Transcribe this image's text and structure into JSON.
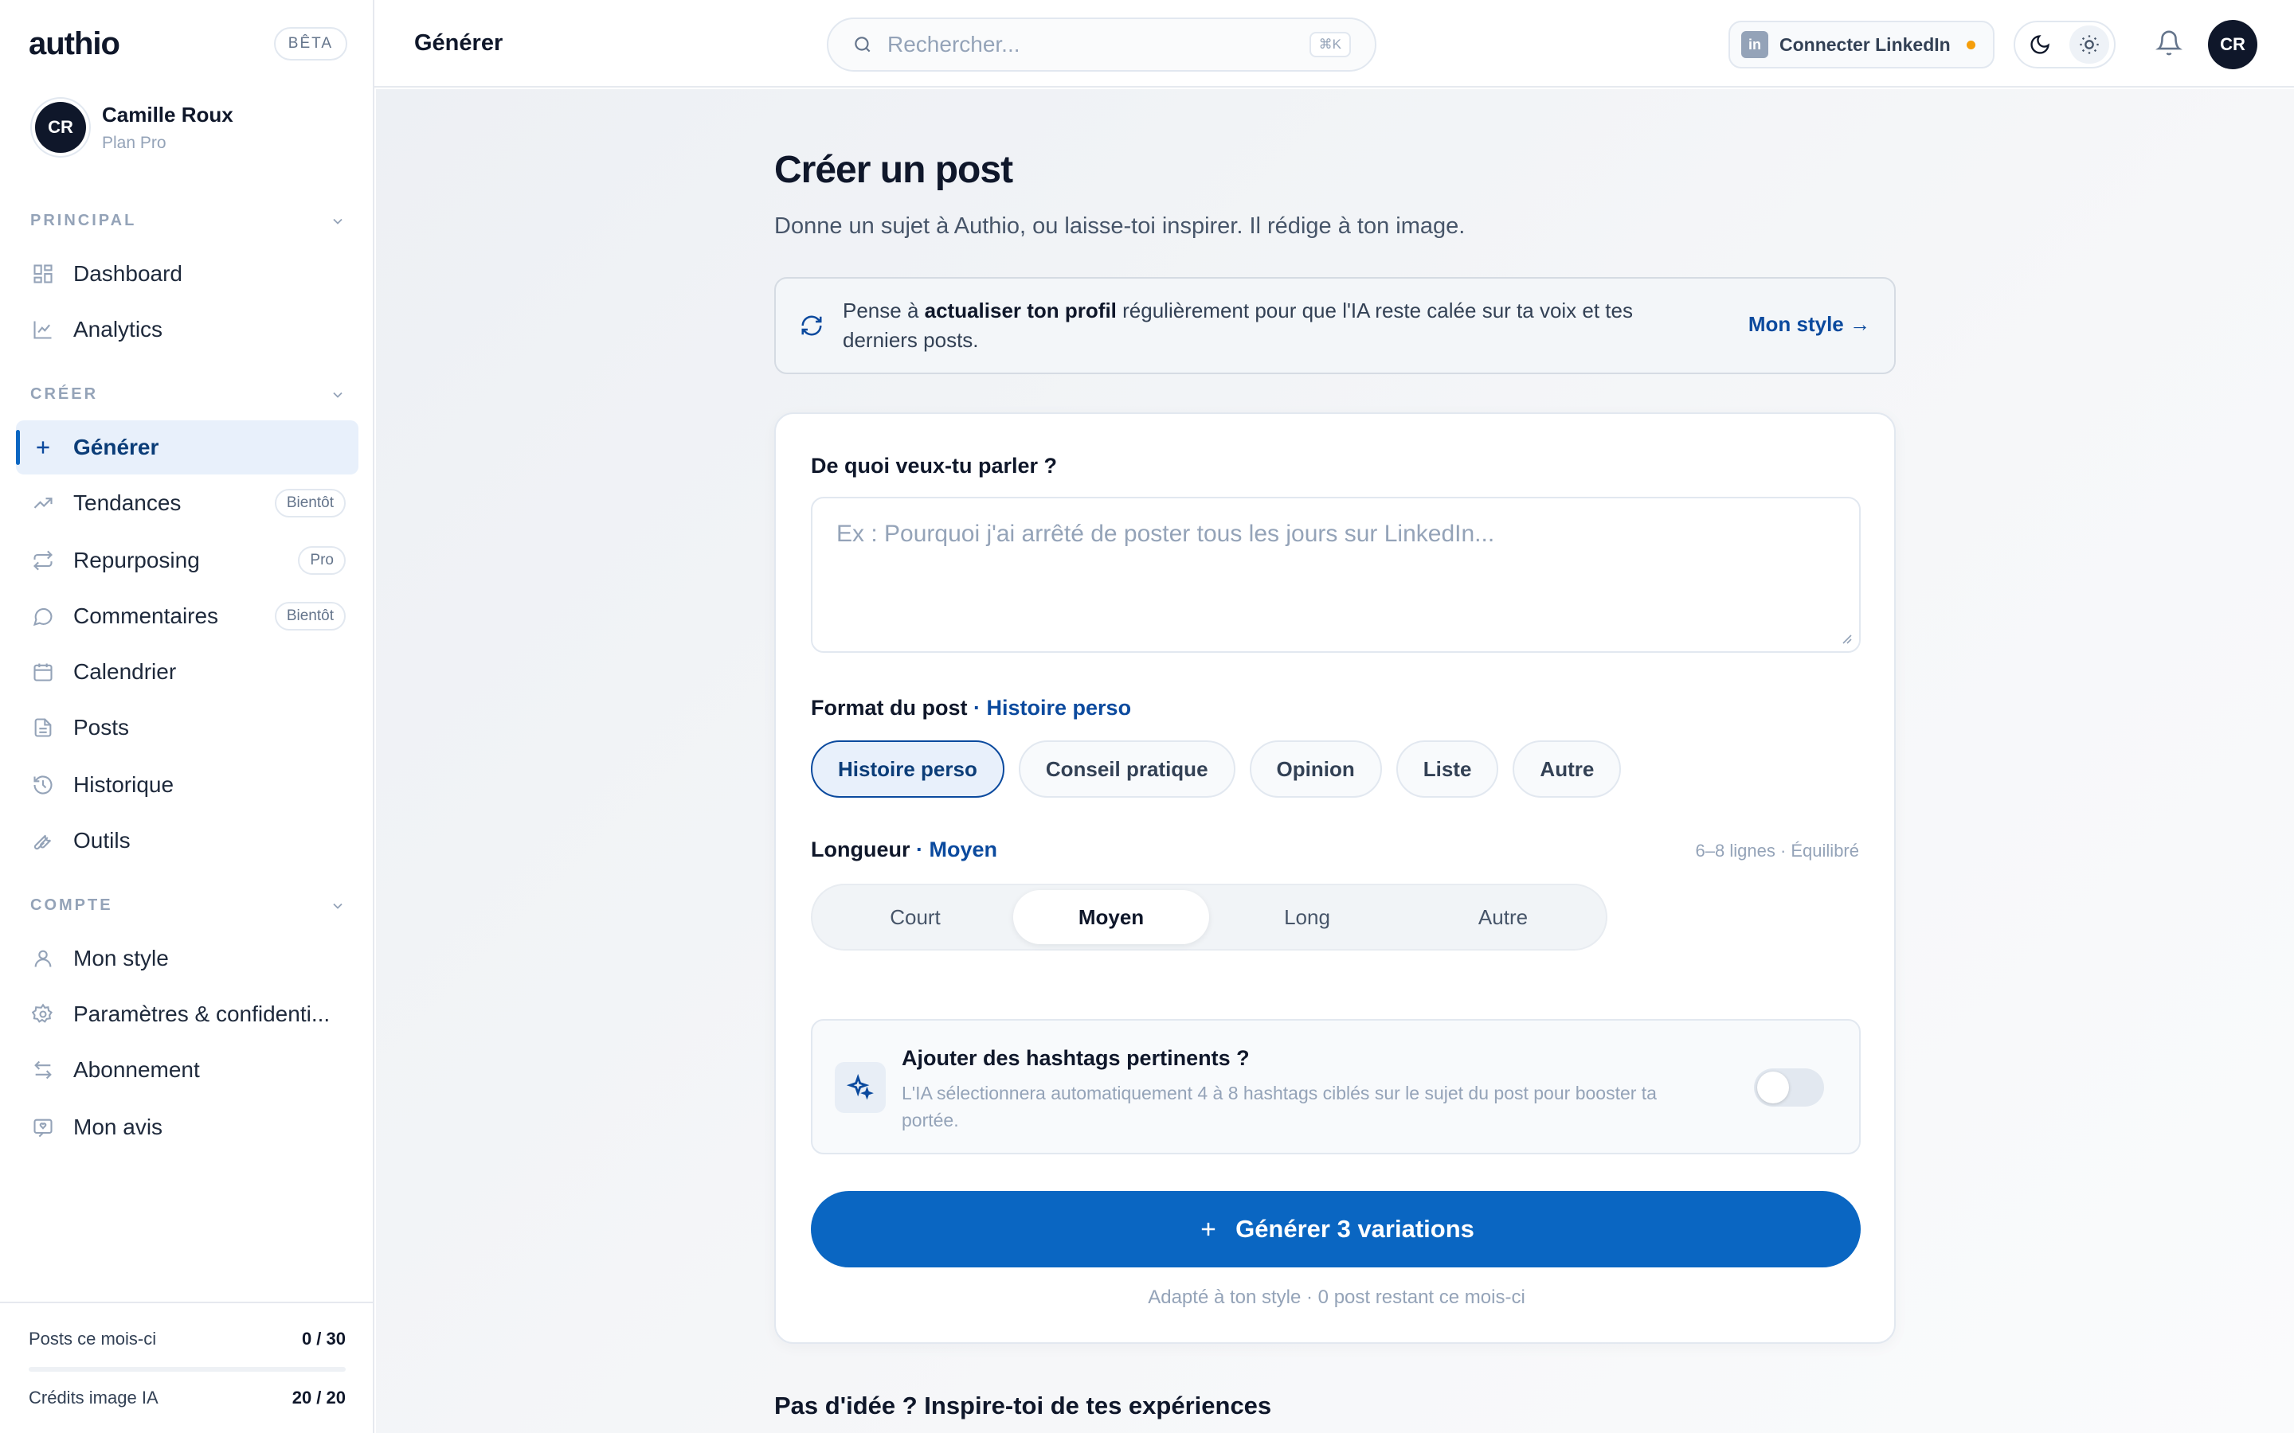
{
  "sidebar": {
    "brand": "authio",
    "beta": "BÊTA",
    "user": {
      "initials": "CR",
      "name": "Camille Roux",
      "plan": "Plan Pro"
    },
    "sections": {
      "principal": "PRINCIPAL",
      "creer": "CRÉER",
      "compte": "COMPTE"
    },
    "items": {
      "dashboard": "Dashboard",
      "analytics": "Analytics",
      "generer": "Générer",
      "tendances": "Tendances",
      "tendances_badge": "Bientôt",
      "repurposing": "Repurposing",
      "repurposing_badge": "Pro",
      "commentaires": "Commentaires",
      "commentaires_badge": "Bientôt",
      "calendrier": "Calendrier",
      "posts": "Posts",
      "historique": "Historique",
      "outils": "Outils",
      "mon_style": "Mon style",
      "parametres": "Paramètres & confidenti...",
      "abonnement": "Abonnement",
      "mon_avis": "Mon avis"
    },
    "quota": {
      "posts_label": "Posts ce mois-ci",
      "posts_value": "0 / 30",
      "posts_fraction": 0,
      "images_label": "Crédits image IA",
      "images_value": "20 / 20"
    }
  },
  "topbar": {
    "title": "Générer",
    "search_placeholder": "Rechercher...",
    "search_shortcut": "⌘K",
    "linkedin": "Connecter LinkedIn",
    "linkedin_icon": "in",
    "avatar": "CR"
  },
  "main": {
    "title": "Créer un post",
    "subtitle": "Donne un sujet à Authio, ou laisse-toi inspirer. Il rédige à ton image.",
    "tip": {
      "before": "Pense à ",
      "bold": "actualiser ton profil",
      "after": " régulièrement pour que l'IA reste calée sur ta voix et tes derniers posts.",
      "link": "Mon style →"
    },
    "form": {
      "topic_label": "De quoi veux-tu parler ?",
      "topic_placeholder": "Ex : Pourquoi j'ai arrêté de poster tous les jours sur LinkedIn...",
      "format_label": "Format du post",
      "format_selected": "· Histoire perso",
      "formats": [
        "Histoire perso",
        "Conseil pratique",
        "Opinion",
        "Liste",
        "Autre"
      ],
      "length_label": "Longueur",
      "length_selected": "· Moyen",
      "length_hint": "6–8 lignes · Équilibré",
      "lengths": [
        "Court",
        "Moyen",
        "Long",
        "Autre"
      ],
      "hashtags_title": "Ajouter des hashtags pertinents ?",
      "hashtags_desc": "L'IA sélectionnera automatiquement 4 à 8 hashtags ciblés sur le sujet du post pour booster ta portée.",
      "hashtags_enabled": false,
      "generate_label": "Générer 3 variations",
      "generate_note": "Adapté à ton style · 0 post restant ce mois-ci"
    },
    "inspire_title": "Pas d'idée ? Inspire-toi de tes expériences"
  },
  "colors": {
    "accent": "#0a66c2",
    "accent_dark": "#0b4a9e",
    "status_warning": "#f59e0b"
  }
}
